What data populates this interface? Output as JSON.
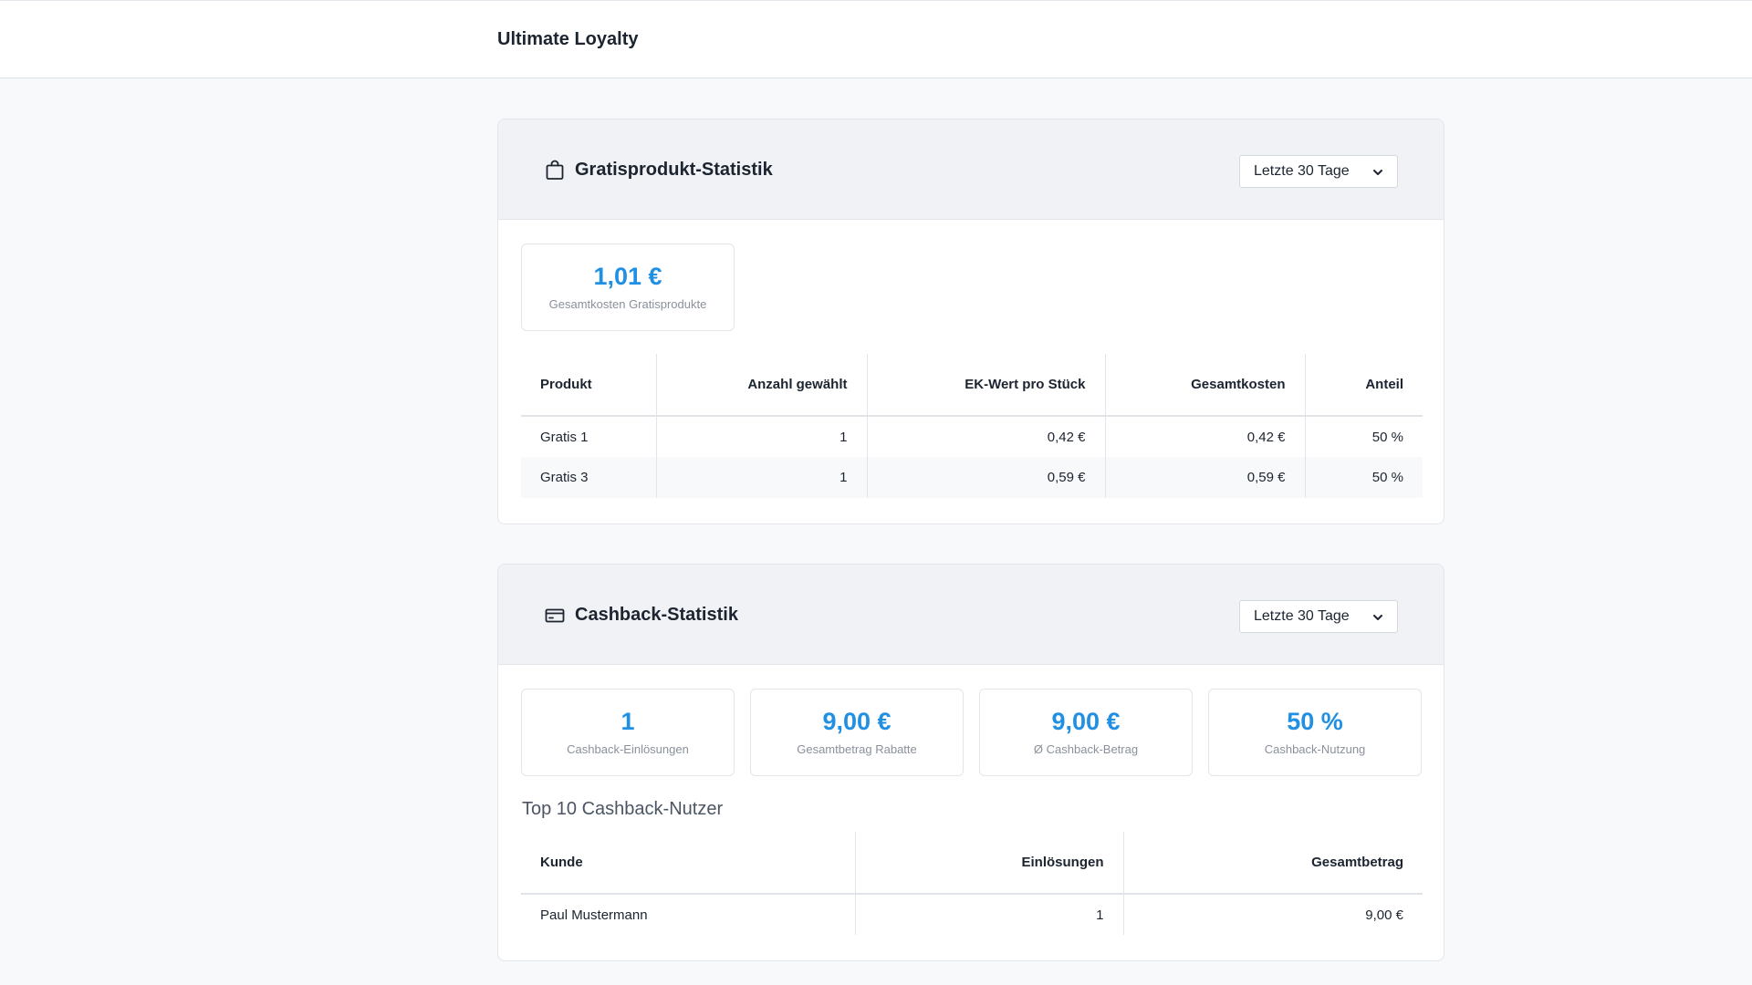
{
  "app": {
    "title": "Ultimate Loyalty"
  },
  "colors": {
    "accent": "#2190e3",
    "header_bg": "#f1f2f5",
    "page_bg": "#f8f9fb"
  },
  "gratis": {
    "icon": "shopping-bag-icon",
    "title": "Gratisprodukt-Statistik",
    "period": "Letzte 30 Tage",
    "stat": {
      "value": "1,01 €",
      "label": "Gesamtkosten Gratisprodukte"
    },
    "table": {
      "headers": [
        "Produkt",
        "Anzahl gewählt",
        "EK-Wert pro Stück",
        "Gesamtkosten",
        "Anteil"
      ],
      "rows": [
        [
          "Gratis 1",
          "1",
          "0,42 €",
          "0,42 €",
          "50 %"
        ],
        [
          "Gratis 3",
          "1",
          "0,59 €",
          "0,59 €",
          "50 %"
        ]
      ]
    }
  },
  "cashback": {
    "icon": "credit-card-icon",
    "title": "Cashback-Statistik",
    "period": "Letzte 30 Tage",
    "stats": [
      {
        "value": "1",
        "label": "Cashback-Einlösungen"
      },
      {
        "value": "9,00 €",
        "label": "Gesamtbetrag Rabatte"
      },
      {
        "value": "9,00 €",
        "label": "Ø Cashback-Betrag"
      },
      {
        "value": "50 %",
        "label": "Cashback-Nutzung"
      }
    ],
    "top_title": "Top 10 Cashback-Nutzer",
    "table": {
      "headers": [
        "Kunde",
        "Einlösungen",
        "Gesamtbetrag"
      ],
      "rows": [
        [
          "Paul Mustermann",
          "1",
          "9,00 €"
        ]
      ]
    }
  }
}
